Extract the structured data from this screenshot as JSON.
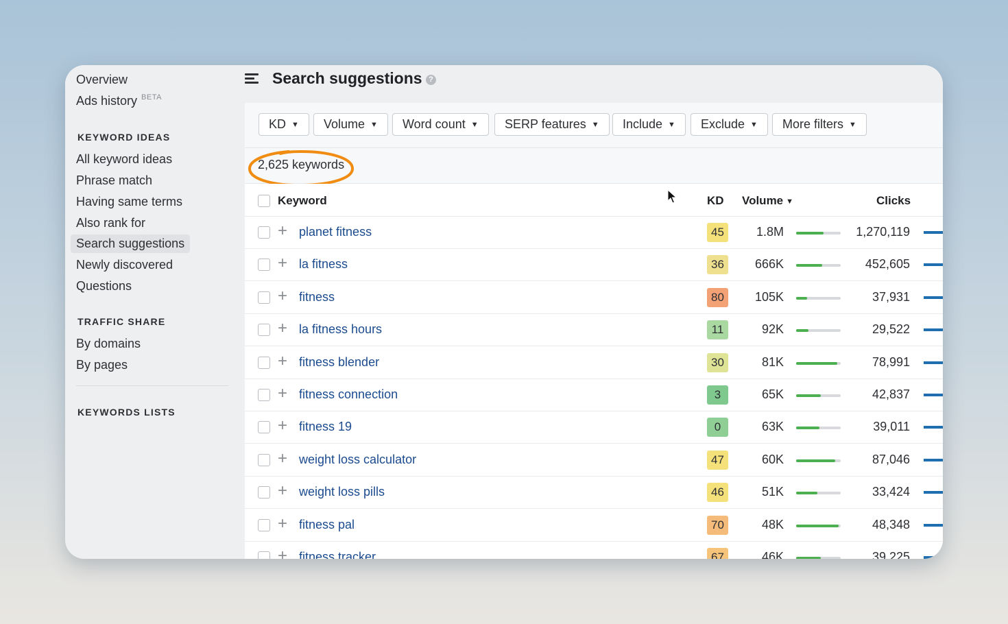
{
  "sidebar": {
    "overview": "Overview",
    "ads_history": "Ads history",
    "ads_history_badge": "BETA",
    "keyword_ideas_heading": "KEYWORD IDEAS",
    "keyword_ideas": [
      "All keyword ideas",
      "Phrase match",
      "Having same terms",
      "Also rank for",
      "Search suggestions",
      "Newly discovered",
      "Questions"
    ],
    "traffic_share_heading": "TRAFFIC SHARE",
    "traffic_share": [
      "By domains",
      "By pages"
    ],
    "keywords_lists_heading": "KEYWORDS LISTS"
  },
  "header": {
    "title": "Search suggestions",
    "help": "?"
  },
  "filters": [
    "KD",
    "Volume",
    "Word count",
    "SERP features",
    "Include",
    "Exclude",
    "More filters"
  ],
  "count": "2,625 keywords",
  "table": {
    "columns": {
      "keyword": "Keyword",
      "kd": "KD",
      "volume": "Volume",
      "clicks": "Clicks"
    },
    "rows": [
      {
        "keyword": "planet fitness",
        "kd": "45",
        "kd_color": "#f5e17a",
        "volume": "1.8M",
        "volume_level": 0.62,
        "clicks": "1,270,119"
      },
      {
        "keyword": "la fitness",
        "kd": "36",
        "kd_color": "#eee08e",
        "volume": "666K",
        "volume_level": 0.58,
        "clicks": "452,605"
      },
      {
        "keyword": "fitness",
        "kd": "80",
        "kd_color": "#f3a276",
        "volume": "105K",
        "volume_level": 0.25,
        "clicks": "37,931"
      },
      {
        "keyword": "la fitness hours",
        "kd": "11",
        "kd_color": "#a9d8a1",
        "volume": "92K",
        "volume_level": 0.28,
        "clicks": "29,522"
      },
      {
        "keyword": "fitness blender",
        "kd": "30",
        "kd_color": "#dfe396",
        "volume": "81K",
        "volume_level": 0.92,
        "clicks": "78,991"
      },
      {
        "keyword": "fitness connection",
        "kd": "3",
        "kd_color": "#7fc98e",
        "volume": "65K",
        "volume_level": 0.55,
        "clicks": "42,837"
      },
      {
        "keyword": "fitness 19",
        "kd": "0",
        "kd_color": "#8fcf95",
        "volume": "63K",
        "volume_level": 0.52,
        "clicks": "39,011"
      },
      {
        "keyword": "weight loss calculator",
        "kd": "47",
        "kd_color": "#f5e17a",
        "volume": "60K",
        "volume_level": 0.88,
        "clicks": "87,046"
      },
      {
        "keyword": "weight loss pills",
        "kd": "46",
        "kd_color": "#f5e17a",
        "volume": "51K",
        "volume_level": 0.48,
        "clicks": "33,424"
      },
      {
        "keyword": "fitness pal",
        "kd": "70",
        "kd_color": "#f5bb7a",
        "volume": "48K",
        "volume_level": 0.95,
        "clicks": "48,348"
      },
      {
        "keyword": "fitness tracker",
        "kd": "67",
        "kd_color": "#f5c37a",
        "volume": "46K",
        "volume_level": 0.55,
        "clicks": "39,225"
      }
    ]
  }
}
